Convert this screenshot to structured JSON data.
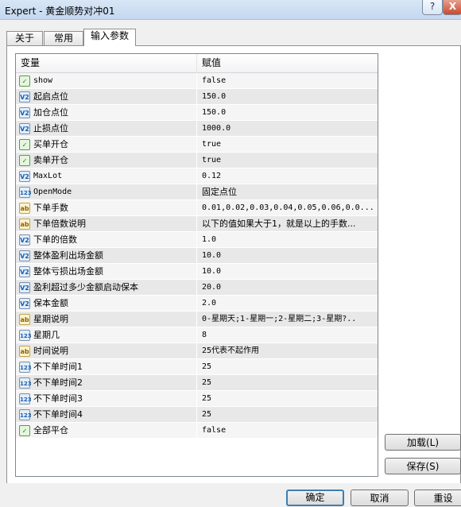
{
  "window": {
    "title": "Expert - 黄金顺势对冲01",
    "help": "?",
    "close": "X"
  },
  "tabs": [
    {
      "label": "关于"
    },
    {
      "label": "常用"
    },
    {
      "label": "输入参数"
    }
  ],
  "grid": {
    "headers": {
      "variable": "变量",
      "value": "赋值"
    },
    "rows": [
      {
        "type": "bool",
        "icon": "bool-icon",
        "name": "show",
        "value": "false"
      },
      {
        "type": "double",
        "icon": "double-icon",
        "name": "起启点位",
        "value": "150.0"
      },
      {
        "type": "double",
        "icon": "double-icon",
        "name": "加仓点位",
        "value": "150.0"
      },
      {
        "type": "double",
        "icon": "double-icon",
        "name": "止损点位",
        "value": "1000.0"
      },
      {
        "type": "bool",
        "icon": "bool-icon",
        "name": "买单开仓",
        "value": "true"
      },
      {
        "type": "bool",
        "icon": "bool-icon",
        "name": "卖单开仓",
        "value": "true"
      },
      {
        "type": "double",
        "icon": "double-icon",
        "name": "MaxLot",
        "value": "0.12"
      },
      {
        "type": "int",
        "icon": "int-icon",
        "name": "OpenMode",
        "value": "固定点位"
      },
      {
        "type": "string",
        "icon": "string-icon",
        "name": "下单手数",
        "value": "0.01,0.02,0.03,0.04,0.05,0.06,0.0..."
      },
      {
        "type": "string",
        "icon": "string-icon",
        "name": "下单倍数说明",
        "value": "以下的值如果大于1，就是以上的手数..."
      },
      {
        "type": "double",
        "icon": "double-icon",
        "name": "下单的倍数",
        "value": "1.0"
      },
      {
        "type": "double",
        "icon": "double-icon",
        "name": "整体盈利出场金额",
        "value": "10.0"
      },
      {
        "type": "double",
        "icon": "double-icon",
        "name": "整体亏损出场金额",
        "value": "10.0"
      },
      {
        "type": "double",
        "icon": "double-icon",
        "name": "盈利超过多少金额启动保本",
        "value": "20.0"
      },
      {
        "type": "double",
        "icon": "double-icon",
        "name": "保本金额",
        "value": "2.0"
      },
      {
        "type": "string",
        "icon": "string-icon",
        "name": "星期说明",
        "value": "0-星期天;1-星期一;2-星期二;3-星期?.."
      },
      {
        "type": "int",
        "icon": "int-icon",
        "name": "星期几",
        "value": "8"
      },
      {
        "type": "string",
        "icon": "string-icon",
        "name": "时间说明",
        "value": "25代表不起作用"
      },
      {
        "type": "int",
        "icon": "int-icon",
        "name": "不下单时间1",
        "value": "25"
      },
      {
        "type": "int",
        "icon": "int-icon",
        "name": "不下单时间2",
        "value": "25"
      },
      {
        "type": "int",
        "icon": "int-icon",
        "name": "不下单时间3",
        "value": "25"
      },
      {
        "type": "int",
        "icon": "int-icon",
        "name": "不下单时间4",
        "value": "25"
      },
      {
        "type": "bool",
        "icon": "bool-icon",
        "name": "全部平仓",
        "value": "false"
      }
    ]
  },
  "side_buttons": {
    "load": "加载(L)",
    "save": "保存(S)"
  },
  "bottom_buttons": {
    "ok": "确定",
    "cancel": "取消",
    "reset": "重设"
  },
  "icon_glyphs": {
    "bool": "✓",
    "double": "V2",
    "int": "123",
    "string": "ab"
  }
}
